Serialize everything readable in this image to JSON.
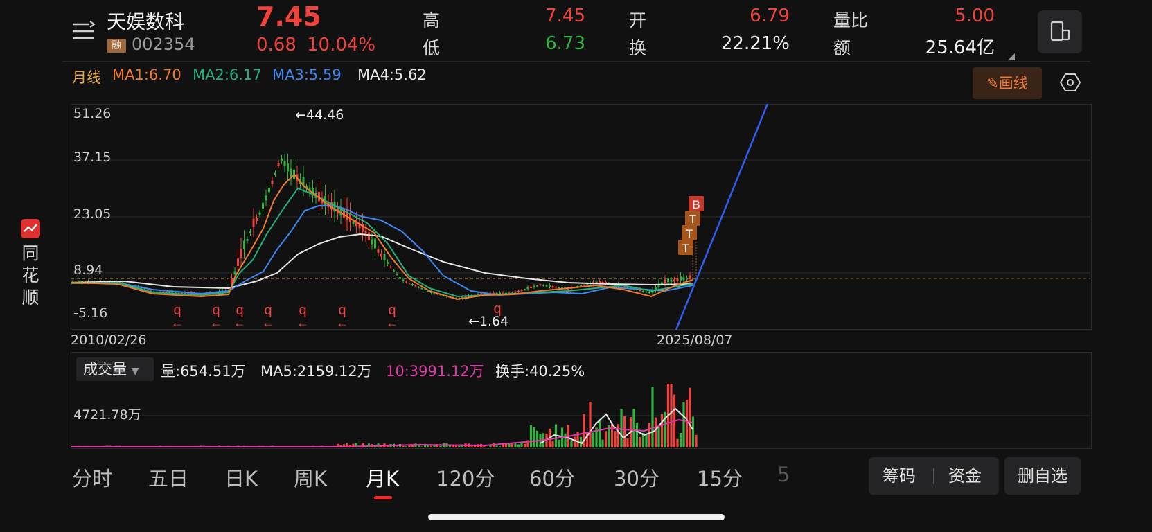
{
  "app": {
    "name_vertical": [
      "同",
      "花",
      "顺"
    ]
  },
  "header": {
    "stock_name": "天娱数科",
    "badge": "融",
    "code": "002354",
    "price": "7.45",
    "change": "0.68",
    "change_pct": "10.04%",
    "stats": {
      "high_label": "高",
      "high": "7.45",
      "low_label": "低",
      "low": "6.73",
      "open_label": "开",
      "open": "6.79",
      "turnover_label": "换",
      "turnover": "22.21%",
      "vol_ratio_label": "量比",
      "vol_ratio": "5.00",
      "amount_label": "额",
      "amount": "25.64亿"
    }
  },
  "ma_row": {
    "period": "月线",
    "ma1": "MA1:6.70",
    "ma2": "MA2:6.17",
    "ma3": "MA3:5.59",
    "ma4": "MA4:5.62",
    "draw_button": "画线"
  },
  "colors": {
    "up": "#f2413a",
    "down": "#2fb33c",
    "ma1": "#f07a2a",
    "ma2": "#21b07a",
    "ma3": "#3f86f0",
    "ma4": "#e6e6e6",
    "trend": "#2f5ef0",
    "ma10_vol": "#e03aa8"
  },
  "chart": {
    "y_ticks": [
      "51.26",
      "37.15",
      "23.05",
      "8.94",
      "-5.16"
    ],
    "high_marker": "←44.46",
    "low_marker": "←1.64",
    "start_date": "2010/02/26",
    "end_date": "2025/08/07",
    "q_marker": "q",
    "arrow_marker": "←",
    "signals": [
      "B",
      "T",
      "T",
      "T"
    ]
  },
  "volume": {
    "indicator": "成交量",
    "vol": "量:654.51万",
    "ma5": "MA5:2159.12万",
    "ma10": "10:3991.12万",
    "turnover": "换手:40.25%",
    "axis_label": "4721.78万"
  },
  "tabs": [
    "分时",
    "五日",
    "日K",
    "周K",
    "月K",
    "120分",
    "60分",
    "30分",
    "15分",
    "5"
  ],
  "buttons": {
    "chips": "筹码",
    "funds": "资金",
    "remove": "删自选"
  }
}
